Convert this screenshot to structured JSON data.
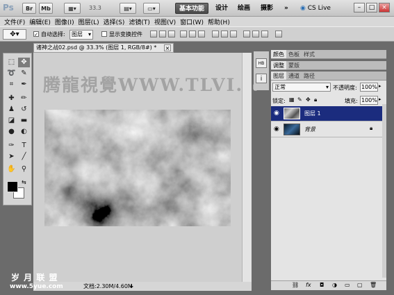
{
  "app": {
    "logo": "Ps",
    "bridge_button": "Br",
    "minibridge_button": "Mb",
    "zoom": "33.3",
    "workspaces": [
      "基本功能",
      "设计",
      "绘画",
      "摄影"
    ],
    "more": "»",
    "cs_live": "CS Live",
    "win_min": "–",
    "win_max": "□",
    "win_close": "×"
  },
  "menu": [
    "文件(F)",
    "编辑(E)",
    "图像(I)",
    "图层(L)",
    "选择(S)",
    "滤镜(T)",
    "视图(V)",
    "窗口(W)",
    "帮助(H)"
  ],
  "options": {
    "auto_select_label": "自动选择:",
    "auto_select_value": "图层",
    "show_transform": "显示变换控件"
  },
  "document": {
    "tab_title": "诸神之战02.psd @ 33.3% (图层 1, RGB/8#) *",
    "tab_close": "×",
    "status": "文档:2.30M/4.60M"
  },
  "watermark": "腾龍視覺WWW.TLVI.N",
  "panels": {
    "group1_tabs": [
      "颜色",
      "色板",
      "样式"
    ],
    "group2_tabs": [
      "调整",
      "蒙版"
    ],
    "group3_tabs": [
      "图层",
      "通道",
      "路径"
    ]
  },
  "layers": {
    "blend_mode": "正常",
    "opacity_label": "不透明度:",
    "opacity": "100%",
    "lock_label": "锁定:",
    "fill_label": "填充:",
    "fill": "100%",
    "items": [
      {
        "name": "图层 1",
        "selected": true
      },
      {
        "name": "背景",
        "selected": false
      }
    ]
  },
  "footer_logo": {
    "line1": "岁 月 联 盟",
    "line2": "www.5yue.com"
  }
}
